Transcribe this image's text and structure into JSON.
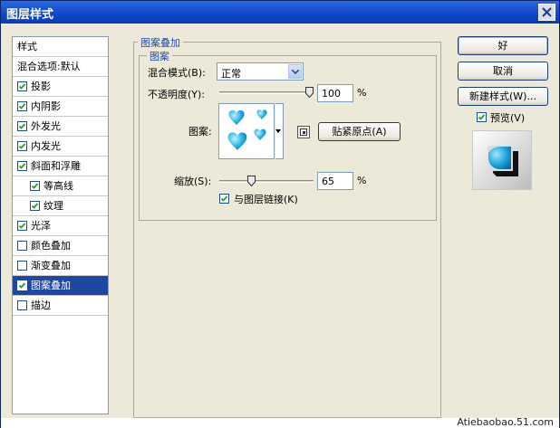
{
  "window": {
    "title": "图层样式"
  },
  "styles_panel": {
    "items": [
      {
        "label": "样式",
        "checkbox": false,
        "checked": false,
        "indent": 0,
        "selected": false
      },
      {
        "label": "混合选项:默认",
        "checkbox": false,
        "checked": false,
        "indent": 0,
        "selected": false
      },
      {
        "label": "投影",
        "checkbox": true,
        "checked": true,
        "indent": 0,
        "selected": false
      },
      {
        "label": "内阴影",
        "checkbox": true,
        "checked": true,
        "indent": 0,
        "selected": false
      },
      {
        "label": "外发光",
        "checkbox": true,
        "checked": true,
        "indent": 0,
        "selected": false
      },
      {
        "label": "内发光",
        "checkbox": true,
        "checked": true,
        "indent": 0,
        "selected": false
      },
      {
        "label": "斜面和浮雕",
        "checkbox": true,
        "checked": true,
        "indent": 0,
        "selected": false
      },
      {
        "label": "等高线",
        "checkbox": true,
        "checked": true,
        "indent": 1,
        "selected": false
      },
      {
        "label": "纹理",
        "checkbox": true,
        "checked": true,
        "indent": 1,
        "selected": false
      },
      {
        "label": "光泽",
        "checkbox": true,
        "checked": true,
        "indent": 0,
        "selected": false
      },
      {
        "label": "颜色叠加",
        "checkbox": true,
        "checked": false,
        "indent": 0,
        "selected": false
      },
      {
        "label": "渐变叠加",
        "checkbox": true,
        "checked": false,
        "indent": 0,
        "selected": false
      },
      {
        "label": "图案叠加",
        "checkbox": true,
        "checked": true,
        "indent": 0,
        "selected": true
      },
      {
        "label": "描边",
        "checkbox": true,
        "checked": false,
        "indent": 0,
        "selected": false
      }
    ]
  },
  "pattern_overlay": {
    "group_title": "图案叠加",
    "section_title": "图案",
    "blend_mode_label": "混合模式(B):",
    "blend_mode_value": "正常",
    "opacity_label": "不透明度(Y):",
    "opacity_value": "100",
    "opacity_percent": 1.0,
    "percent_sign": "%",
    "pattern_label": "图案:",
    "snap_button": "贴紧原点(A)",
    "scale_label": "缩放(S):",
    "scale_value": "65",
    "scale_fraction": 0.065,
    "link_label": "与图层链接(K)",
    "link_checked": true,
    "pattern_icon": "blue-hearts-pattern",
    "pattern_color": "#1aa0d8"
  },
  "buttons": {
    "ok": "好",
    "cancel": "取消",
    "new_style": "新建样式(W)...",
    "preview_label": "预览(V)",
    "preview_checked": true
  },
  "footer": {
    "watermark": "Atiebaobao.51.com"
  },
  "colors": {
    "title_bar": "#0f46c8",
    "selection": "#1d47a0",
    "group_title": "#1f4aa8",
    "dialog_bg": "#ece9d8"
  }
}
